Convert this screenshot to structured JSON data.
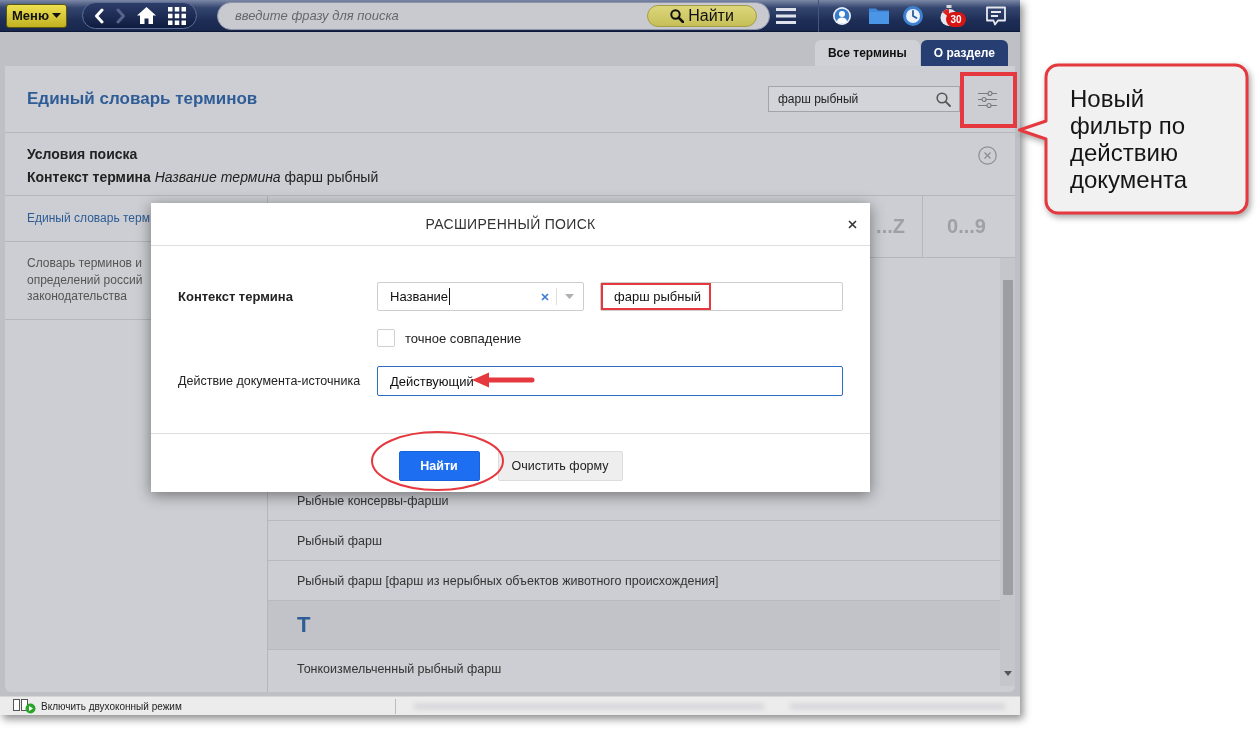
{
  "top_bar": {
    "menu_button": {
      "label": "Меню"
    },
    "search": {
      "placeholder": "введите фразу для поиска",
      "button": "Найти"
    },
    "notifications": {
      "count": "30"
    }
  },
  "tabs": [
    {
      "label": "Все термины",
      "selected": true
    },
    {
      "label": "О разделе",
      "selected": false
    }
  ],
  "header": {
    "title": "Единый словарь терминов",
    "search": {
      "value": "фарш рыбный"
    }
  },
  "search_conditions": {
    "title": "Условия поиска",
    "text": "**Контекст термина** *Название термина* фарш рыбный"
  },
  "sidebar": {
    "items": [
      {
        "label": "Единый словарь терм",
        "selected": true
      },
      {
        "label": "Словарь терминов и\nопределений россий\nзаконодательства",
        "selected": false
      }
    ]
  },
  "alphabet": [
    {
      "label": "...Z"
    },
    {
      "label": "0...9"
    }
  ],
  "list": {
    "rows": [
      {
        "kind": "term",
        "text": "Рыбные консервы-фарши"
      },
      {
        "kind": "term",
        "text": "Рыбный фарш"
      },
      {
        "kind": "term",
        "text": "Рыбный фарш [фарш из нерыбных объектов животного происхождения]"
      },
      {
        "kind": "letter",
        "text": "Т"
      },
      {
        "kind": "term",
        "text": "Тонкоизмельченный рыбный фарш"
      }
    ]
  },
  "dialog": {
    "title": "РАСШИРЕННЫЙ ПОИСК",
    "fields": [
      {
        "kind": "context",
        "label": "Контекст термина",
        "select": {
          "value": "Название",
          "cursor": true
        },
        "input": {
          "value": "фарш рыбный"
        }
      },
      {
        "kind": "checkbox",
        "label": "точное совпадение",
        "checked": false
      },
      {
        "kind": "text",
        "label": "Действие документа-источника",
        "value": "Действующий",
        "focused": true
      }
    ],
    "buttons": [
      {
        "kind": "primary",
        "label": "Найти"
      },
      {
        "kind": "secondary",
        "label": "Очистить форму"
      }
    ]
  },
  "status_bar": {
    "text": "Включить двухоконный режим"
  },
  "callout": {
    "text": "Новый фильтр по действию документа"
  }
}
